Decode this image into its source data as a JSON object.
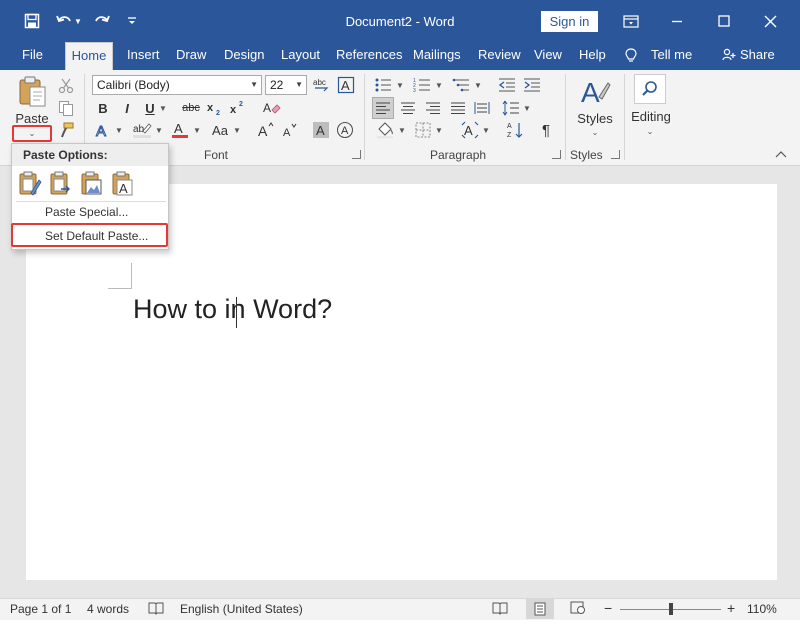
{
  "titlebar": {
    "doc_title": "Document2 - Word",
    "sign_in": "Sign in"
  },
  "tabs": [
    {
      "label": "File"
    },
    {
      "label": "Home"
    },
    {
      "label": "Insert"
    },
    {
      "label": "Draw"
    },
    {
      "label": "Design"
    },
    {
      "label": "Layout"
    },
    {
      "label": "References"
    },
    {
      "label": "Mailings"
    },
    {
      "label": "Review"
    },
    {
      "label": "View"
    },
    {
      "label": "Help"
    },
    {
      "label": "Tell me"
    },
    {
      "label": "Share"
    }
  ],
  "active_tab": "Home",
  "ribbon": {
    "clipboard": {
      "paste_label": "Paste"
    },
    "font": {
      "group_label": "Font",
      "font_name": "Calibri (Body)",
      "font_size": "22",
      "bold": "B",
      "italic": "I",
      "underline": "U",
      "strike": "abc",
      "change_case": "Aa"
    },
    "paragraph": {
      "group_label": "Paragraph"
    },
    "styles": {
      "label": "Styles",
      "group_label": "Styles"
    },
    "editing": {
      "label": "Editing"
    }
  },
  "paste_menu": {
    "header": "Paste Options:",
    "paste_special": "Paste Special...",
    "set_default_paste": "Set Default Paste..."
  },
  "document": {
    "text_before_cursor": "How to ",
    "text_after_cursor": "in Word?"
  },
  "statusbar": {
    "page": "Page 1 of 1",
    "words": "4 words",
    "language": "English (United States)",
    "zoom": "110%",
    "zoom_minus": "−",
    "zoom_plus": "+",
    "zoom_level": 110
  },
  "colors": {
    "accent": "#2b579a",
    "highlight": "#e53935",
    "font_color": "#e53935"
  }
}
